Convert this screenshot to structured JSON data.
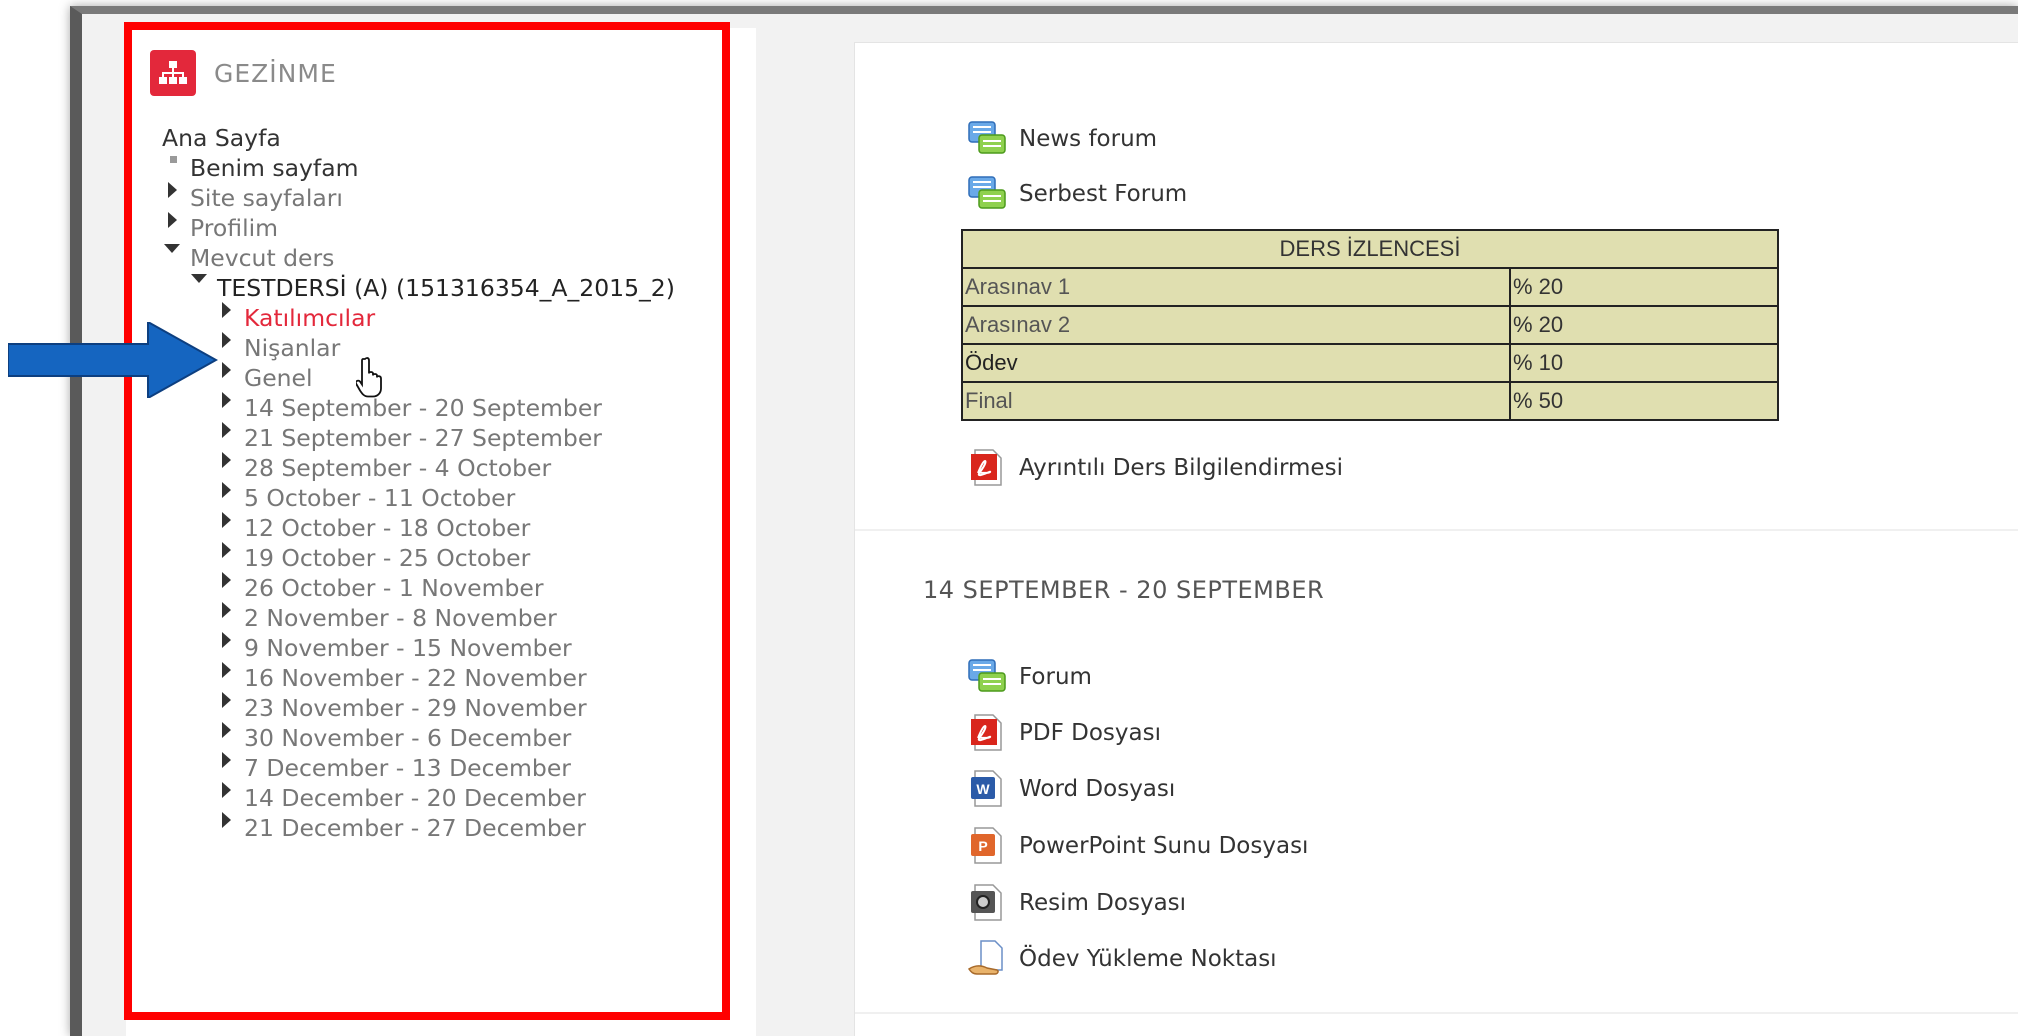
{
  "nav": {
    "title": "GEZİNME",
    "home": "Ana Sayfa",
    "items": [
      {
        "label": "Benim sayfam"
      },
      {
        "label": "Site sayfaları"
      },
      {
        "label": "Profilim"
      },
      {
        "label": "Mevcut ders"
      }
    ],
    "course": "TESTDERSİ (A) (151316354_A_2015_2)",
    "course_items": [
      {
        "label": "Katılımcılar"
      },
      {
        "label": "Nişanlar"
      },
      {
        "label": "Genel"
      },
      {
        "label": "14 September - 20 September"
      },
      {
        "label": "21 September - 27 September"
      },
      {
        "label": "28 September - 4 October"
      },
      {
        "label": "5 October - 11 October"
      },
      {
        "label": "12 October - 18 October"
      },
      {
        "label": "19 October - 25 October"
      },
      {
        "label": "26 October - 1 November"
      },
      {
        "label": "2 November - 8 November"
      },
      {
        "label": "9 November - 15 November"
      },
      {
        "label": "16 November - 22 November"
      },
      {
        "label": "23 November - 29 November"
      },
      {
        "label": "30 November - 6 December"
      },
      {
        "label": "7 December - 13 December"
      },
      {
        "label": "14 December - 20 December"
      },
      {
        "label": "21 December - 27 December"
      }
    ]
  },
  "content": {
    "activities_top": [
      {
        "label": "News forum",
        "icon": "forum-icon"
      },
      {
        "label": "Serbest Forum",
        "icon": "forum-icon"
      }
    ],
    "syllabus": {
      "title": "DERS İZLENCESİ",
      "rows": [
        {
          "name": "Arasınav 1",
          "value": "% 20"
        },
        {
          "name": "Arasınav 2",
          "value": "% 20"
        },
        {
          "name": "Ödev",
          "value": "% 10"
        },
        {
          "name": "Final",
          "value": "% 50"
        }
      ]
    },
    "detail_doc": {
      "label": "Ayrıntılı Ders Bilgilendirmesi",
      "icon": "pdf-icon"
    },
    "section_title": "14 SEPTEMBER - 20 SEPTEMBER",
    "section_activities": [
      {
        "label": "Forum",
        "icon": "forum-icon"
      },
      {
        "label": "PDF Dosyası",
        "icon": "pdf-icon"
      },
      {
        "label": "Word Dosyası",
        "icon": "word-icon"
      },
      {
        "label": "PowerPoint Sunu Dosyası",
        "icon": "powerpoint-icon"
      },
      {
        "label": "Resim Dosyası",
        "icon": "image-file-icon"
      },
      {
        "label": "Ödev Yükleme Noktası",
        "icon": "assignment-icon"
      }
    ]
  },
  "colors": {
    "accent": "#e3283b",
    "highlight_box": "#ff0000",
    "arrow": "#1565c0",
    "table_bg": "#e0dfb0"
  }
}
